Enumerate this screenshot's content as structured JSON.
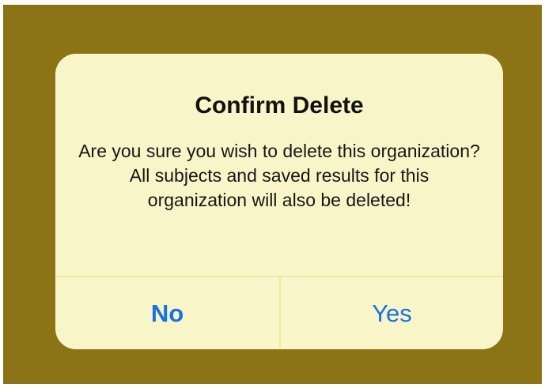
{
  "dialog": {
    "title": "Confirm Delete",
    "message": "Are you sure you wish to delete this organization?  All subjects and saved results for this organization will also be deleted!",
    "buttons": {
      "no_label": "No",
      "yes_label": "Yes"
    }
  },
  "colors": {
    "backdrop": "#8c7416",
    "dialog_background": "#f8f6c8",
    "button_text": "#1a72e2",
    "separator": "#efeaa2"
  }
}
